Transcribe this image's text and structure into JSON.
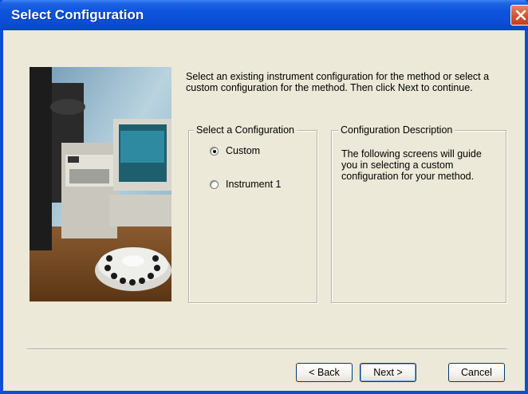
{
  "window": {
    "title": "Select Configuration"
  },
  "instructions": "Select an existing instrument configuration for the method or select a custom configuration for the method. Then click Next to continue.",
  "config_group": {
    "legend": "Select a Configuration",
    "options": [
      {
        "label": "Custom",
        "checked": true
      },
      {
        "label": "Instrument 1",
        "checked": false
      }
    ]
  },
  "description_group": {
    "legend": "Configuration Description",
    "text": "The following screens will guide you in selecting a custom configuration for your method."
  },
  "buttons": {
    "back": "< Back",
    "next": "Next >",
    "cancel": "Cancel"
  },
  "icons": {
    "close": "close-icon",
    "picture": "instrument-photo"
  },
  "colors": {
    "titlebar": "#0a4fd6",
    "close": "#d3542f",
    "face": "#ece9d8"
  }
}
